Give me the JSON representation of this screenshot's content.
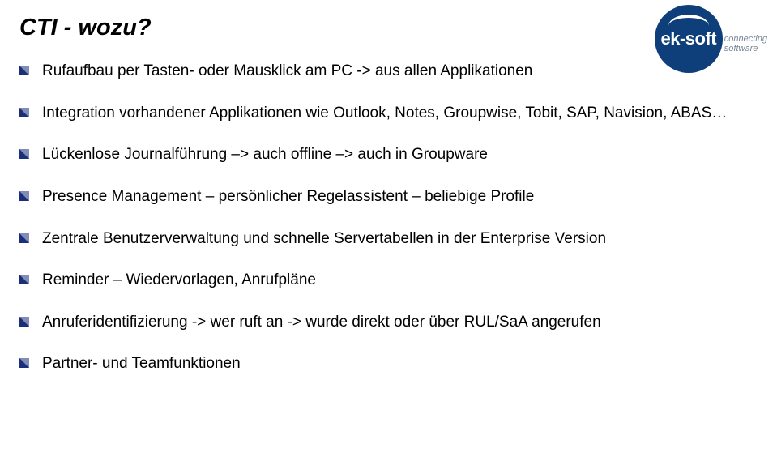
{
  "title": "CTI - wozu?",
  "logo": {
    "brand": "ek-soft",
    "tag1": "connecting",
    "tag2": "software"
  },
  "bullets": [
    "Rufaufbau per Tasten- oder Mausklick am PC -> aus allen Applikationen",
    "Integration vorhandener Applikationen wie Outlook, Notes, Groupwise, Tobit, SAP, Navision, ABAS…",
    "Lückenlose Journalführung –> auch offline –> auch in Groupware",
    "Presence Management – persönlicher Regelassistent – beliebige Profile",
    "Zentrale Benutzerverwaltung und schnelle Servertabellen in der Enterprise Version",
    "Reminder – Wiedervorlagen, Anrufpläne",
    "Anruferidentifizierung -> wer ruft an -> wurde direkt oder über RUL/SaA angerufen",
    "Partner- und Teamfunktionen"
  ]
}
